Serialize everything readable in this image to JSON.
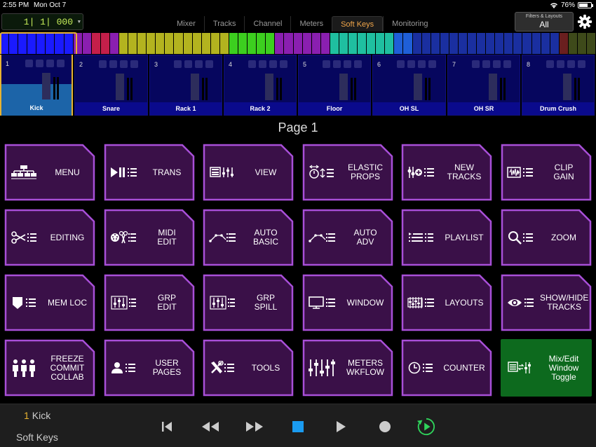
{
  "status": {
    "time": "2:55 PM",
    "date": "Mon Oct 7",
    "battery": "76%",
    "battery_level": 0.76
  },
  "counter": "1| 1| 000",
  "tabs": [
    {
      "label": "Mixer",
      "active": false
    },
    {
      "label": "Tracks",
      "active": false
    },
    {
      "label": "Channel",
      "active": false
    },
    {
      "label": "Meters",
      "active": false
    },
    {
      "label": "Soft Keys",
      "active": true
    },
    {
      "label": "Monitoring",
      "active": false
    }
  ],
  "filters": {
    "label": "Filters & Layouts",
    "value": "All"
  },
  "colors": {
    "accent": "#e8b230",
    "tab_active": "#f1a64a",
    "key_purple": "#3a1048",
    "key_border": "#a84fd8",
    "key_green": "#0d6a1e",
    "play_green": "#2fd35b"
  },
  "strip_colors": [
    "#1a1aff",
    "#1a1aff",
    "#1a1aff",
    "#1a1aff",
    "#1a1aff",
    "#1a1aff",
    "#1a1aff",
    "#1a1aff",
    "#8a1fb0",
    "#8a1fb0",
    "#c41f4a",
    "#c41f4a",
    "#8a1fb0",
    "#b3b31f",
    "#b3b31f",
    "#b3b31f",
    "#b3b31f",
    "#b3b31f",
    "#b3b31f",
    "#b3b31f",
    "#b3b31f",
    "#b3b31f",
    "#b3b31f",
    "#b3b31f",
    "#b3b31f",
    "#3ccf1f",
    "#3ccf1f",
    "#3ccf1f",
    "#3ccf1f",
    "#3ccf1f",
    "#8a1fb0",
    "#8a1fb0",
    "#8a1fb0",
    "#8a1fb0",
    "#8a1fb0",
    "#8a1fb0",
    "#1fbfa0",
    "#1fbfa0",
    "#1fbfa0",
    "#1fbfa0",
    "#1fbfa0",
    "#1fbfa0",
    "#1fbfa0",
    "#1f5fd8",
    "#1f5fd8",
    "#1a2fa0",
    "#1a2fa0",
    "#1a2fa0",
    "#1a2fa0",
    "#1a2fa0",
    "#1a2fa0",
    "#1a2fa0",
    "#1a2fa0",
    "#1a2fa0",
    "#1a2fa0",
    "#1a2fa0",
    "#1a2fa0",
    "#1a2fa0",
    "#1a2fa0",
    "#1a2fa0",
    "#1a2fa0",
    "#6a1f1f",
    "#3e4a1a",
    "#3e4a1a",
    "#3e4a1a"
  ],
  "channels": [
    {
      "num": "1",
      "name": "Kick",
      "selected": true
    },
    {
      "num": "2",
      "name": "Snare",
      "selected": false
    },
    {
      "num": "3",
      "name": "Rack 1",
      "selected": false
    },
    {
      "num": "4",
      "name": "Rack 2",
      "selected": false
    },
    {
      "num": "5",
      "name": "Floor",
      "selected": false
    },
    {
      "num": "6",
      "name": "OH SL",
      "selected": false
    },
    {
      "num": "7",
      "name": "OH SR",
      "selected": false
    },
    {
      "num": "8",
      "name": "Drum Crush",
      "selected": false
    }
  ],
  "page_label": "Page 1",
  "keys": [
    [
      {
        "label": "MENU",
        "icon": "menu-tree-icon"
      },
      {
        "label": "TRANS",
        "icon": "play-pause-list-icon"
      },
      {
        "label": "VIEW",
        "icon": "view-sliders-icon"
      },
      {
        "label": "ELASTIC\nPROPS",
        "icon": "elastic-props-icon"
      },
      {
        "label": "NEW\nTRACKS",
        "icon": "new-tracks-icon"
      },
      {
        "label": "CLIP\nGAIN",
        "icon": "clip-gain-icon"
      }
    ],
    [
      {
        "label": "EDITING",
        "icon": "scissors-list-icon"
      },
      {
        "label": "MIDI\nEDIT",
        "icon": "midi-edit-icon"
      },
      {
        "label": "AUTO\nBASIC",
        "icon": "automation-line-icon"
      },
      {
        "label": "AUTO\nADV",
        "icon": "automation-adv-icon"
      },
      {
        "label": "PLAYLIST",
        "icon": "playlist-icon"
      },
      {
        "label": "ZOOM",
        "icon": "zoom-icon"
      }
    ],
    [
      {
        "label": "MEM LOC",
        "icon": "memory-location-icon"
      },
      {
        "label": "GRP\nEDIT",
        "icon": "group-edit-icon"
      },
      {
        "label": "GRP\nSPILL",
        "icon": "group-spill-icon"
      },
      {
        "label": "WINDOW",
        "icon": "window-monitor-icon"
      },
      {
        "label": "LAYOUTS",
        "icon": "layouts-icon"
      },
      {
        "label": "SHOW/HIDE\nTRACKS",
        "icon": "eye-list-icon"
      }
    ],
    [
      {
        "label": "FREEZE\nCOMMIT\nCOLLAB",
        "icon": "people-icon"
      },
      {
        "label": "USER\nPAGES",
        "icon": "user-list-icon"
      },
      {
        "label": "TOOLS",
        "icon": "tools-icon"
      },
      {
        "label": "METERS\nWKFLOW",
        "icon": "meters-faders-icon"
      },
      {
        "label": "COUNTER",
        "icon": "clock-list-icon"
      },
      {
        "label": "Mix/Edit\nWindow\nToggle",
        "icon": "mix-edit-toggle-icon",
        "green": true
      }
    ]
  ],
  "transport": {
    "track_num": "1",
    "track_name": "Kick",
    "mode": "Soft Keys",
    "buttons": [
      "return-to-zero-icon",
      "rewind-icon",
      "fast-forward-icon",
      "stop-icon",
      "play-icon",
      "record-icon",
      "loop-play-icon"
    ]
  }
}
